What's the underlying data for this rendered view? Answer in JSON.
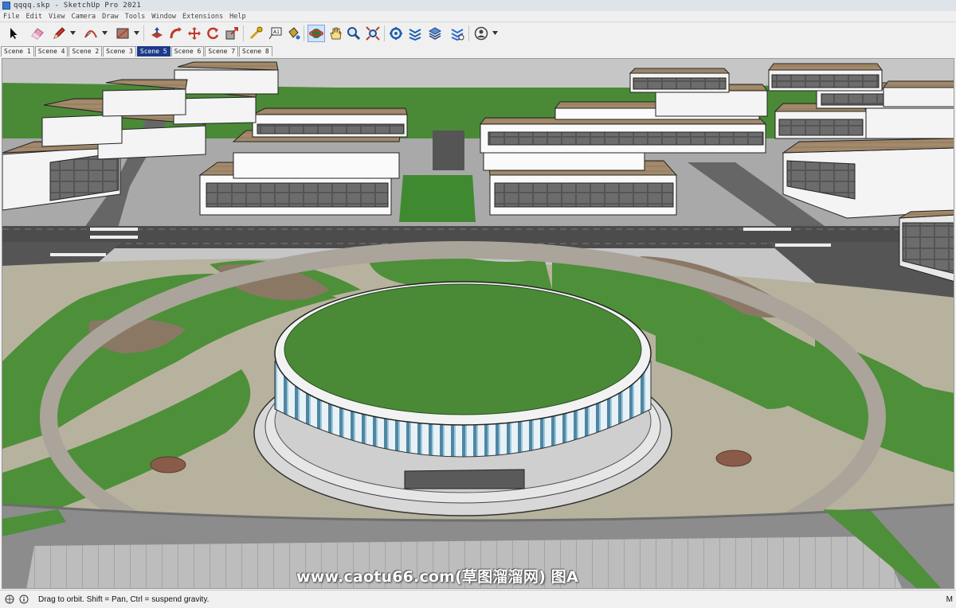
{
  "window": {
    "title": "qqqq.skp - SketchUp Pro 2021"
  },
  "menu": [
    "File",
    "Edit",
    "View",
    "Camera",
    "Draw",
    "Tools",
    "Window",
    "Extensions",
    "Help"
  ],
  "toolbar": {
    "tools": [
      {
        "name": "select-tool-button",
        "icon": "arrow-cursor-icon"
      },
      {
        "name": "eraser-tool-button",
        "icon": "eraser-icon"
      },
      {
        "name": "line-tool-button",
        "icon": "pencil-icon"
      },
      {
        "name": "arc-tool-button",
        "icon": "arc-icon"
      },
      {
        "name": "shape-tool-button",
        "icon": "rectangle-icon"
      },
      {
        "name": "push-pull-tool-button",
        "icon": "push-pull-icon"
      },
      {
        "name": "follow-me-tool-button",
        "icon": "follow-me-icon"
      },
      {
        "name": "move-tool-button",
        "icon": "move-icon"
      },
      {
        "name": "rotate-tool-button",
        "icon": "rotate-icon"
      },
      {
        "name": "scale-tool-button",
        "icon": "scale-icon"
      },
      {
        "name": "tape-measure-tool-button",
        "icon": "tape-measure-icon"
      },
      {
        "name": "text-tool-button",
        "icon": "text-icon"
      },
      {
        "name": "paint-bucket-tool-button",
        "icon": "paint-bucket-icon"
      },
      {
        "name": "orbit-tool-button",
        "icon": "orbit-icon",
        "active": true
      },
      {
        "name": "pan-tool-button",
        "icon": "hand-icon"
      },
      {
        "name": "zoom-tool-button",
        "icon": "magnifier-icon"
      },
      {
        "name": "zoom-extents-tool-button",
        "icon": "zoom-extents-icon"
      },
      {
        "name": "warehouse-button",
        "icon": "3d-warehouse-icon"
      },
      {
        "name": "extension-warehouse-button",
        "icon": "extension-warehouse-icon"
      },
      {
        "name": "trimble-connect-button",
        "icon": "layers-stack-icon"
      },
      {
        "name": "extension-manager-button",
        "icon": "extension-manager-icon"
      },
      {
        "name": "account-button",
        "icon": "user-account-icon"
      }
    ]
  },
  "scenes": [
    {
      "label": "Scene 1",
      "active": false
    },
    {
      "label": "Scene 4",
      "active": false
    },
    {
      "label": "Scene 2",
      "active": false
    },
    {
      "label": "Scene 3",
      "active": false
    },
    {
      "label": "Scene 5",
      "active": true
    },
    {
      "label": "Scene 6",
      "active": false
    },
    {
      "label": "Scene 7",
      "active": false
    },
    {
      "label": "Scene 8",
      "active": false
    }
  ],
  "watermark": "www.caotu66.com(草图溜溜网) 图A",
  "status": {
    "hint": "Drag to orbit. Shift = Pan, Ctrl = suspend gravity.",
    "measurements_label": "M"
  },
  "colors": {
    "grass": "#4e8f3a",
    "roof": "#a38a6b",
    "road": "#5c5c5c",
    "plaza": "#c3bca4",
    "active_tab": "#1c3b8a"
  }
}
